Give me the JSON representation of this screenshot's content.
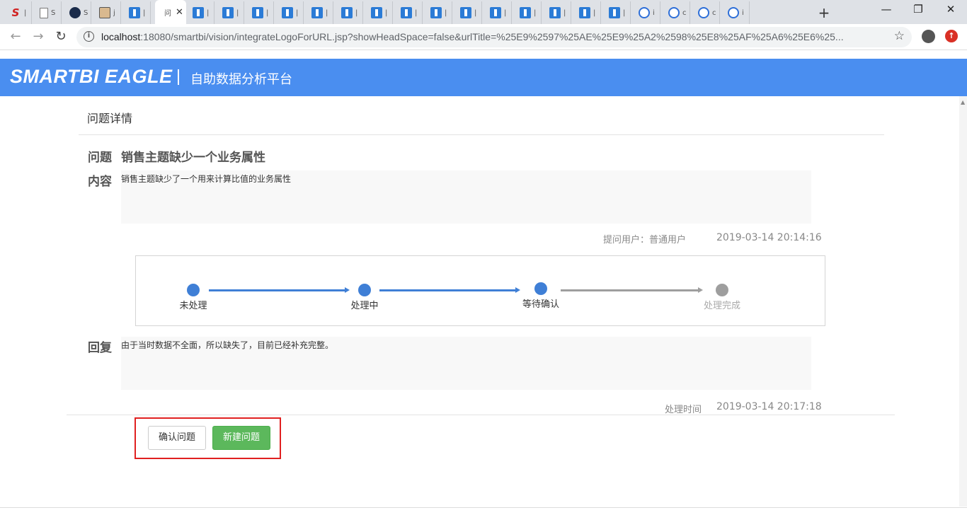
{
  "browser": {
    "tabs": [
      {
        "favicon": "smartbi-red-icon",
        "title_hint": "S",
        "partial_title": "|"
      },
      {
        "favicon": "document-icon",
        "partial_title": "S"
      },
      {
        "favicon": "hawk-icon",
        "partial_title": "S"
      },
      {
        "favicon": "image-icon",
        "partial_title": "j"
      },
      {
        "favicon": "blue-app-icon",
        "partial_title": "|"
      },
      {
        "favicon": "blue-app-icon",
        "partial_title": "|"
      },
      {
        "favicon": "blue-app-icon",
        "partial_title": "|"
      },
      {
        "favicon": "blue-app-icon",
        "partial_title": "|"
      },
      {
        "favicon": "blue-app-icon",
        "partial_title": "|"
      },
      {
        "favicon": "blue-app-icon",
        "partial_title": "|"
      },
      {
        "favicon": "blue-app-icon",
        "partial_title": "|"
      },
      {
        "favicon": "blue-app-icon",
        "partial_title": "|"
      },
      {
        "favicon": "blue-app-icon",
        "partial_title": "|"
      },
      {
        "favicon": "blue-app-icon",
        "partial_title": "|"
      },
      {
        "favicon": "blue-app-icon",
        "partial_title": "|"
      },
      {
        "favicon": "blue-app-icon",
        "partial_title": "|"
      },
      {
        "favicon": "blue-app-icon",
        "partial_title": "|"
      },
      {
        "favicon": "blue-app-icon",
        "partial_title": "|"
      },
      {
        "favicon": "blue-app-icon",
        "partial_title": "|"
      },
      {
        "favicon": "blue-app-icon",
        "partial_title": "|"
      },
      {
        "favicon": "paw-icon",
        "partial_title": "i"
      },
      {
        "favicon": "paw-icon",
        "partial_title": "c"
      },
      {
        "favicon": "paw-icon",
        "partial_title": "c"
      },
      {
        "favicon": "paw-icon",
        "partial_title": "i"
      }
    ],
    "active_tab": {
      "partial_title": "问",
      "close": "✕"
    },
    "new_tab": "+",
    "window_controls": {
      "minimize": "—",
      "restore": "❐",
      "close": "✕"
    },
    "nav": {
      "back": "←",
      "forward": "→",
      "reload": "↻"
    },
    "url_host": "localhost",
    "url_rest": ":18080/smartbi/vision/integrateLogoForURL.jsp?showHeadSpace=false&urlTitle=%25E9%2597%25AE%25E9%25A2%2598%25E8%25AF%25A6%25E6%25...",
    "info_icon": "i",
    "bookmark_star": "☆",
    "update_badge": "↑"
  },
  "app": {
    "logo": "SMARTBI EAGLE",
    "subtitle": "自助数据分析平台",
    "header_color": "#4a8ef0"
  },
  "page": {
    "title": "问题详情",
    "question_label": "问题",
    "question_title": "销售主题缺少一个业务属性",
    "content_label": "内容",
    "content_text": "销售主题缺少了一个用来计算比值的业务属性",
    "asker": "提问用户：普通用户",
    "ask_time": "2019-03-14 20:14:16",
    "reply_label": "回复",
    "reply_text": "由于当时数据不全面，所以缺失了，目前已经补充完整。",
    "handle_label": "处理时间",
    "handle_time": "2019-03-14 20:17:18"
  },
  "progress": {
    "steps": [
      {
        "label": "未处理",
        "done": true
      },
      {
        "label": "处理中",
        "done": true
      },
      {
        "label": "等待确认",
        "done": true
      },
      {
        "label": "处理完成",
        "done": false
      }
    ],
    "done_color": "#3f7fd6",
    "todo_color": "#9e9e9e"
  },
  "actions": {
    "confirm_label": "确认问题",
    "create_label": "新建问题",
    "create_color": "#5cb85c"
  }
}
